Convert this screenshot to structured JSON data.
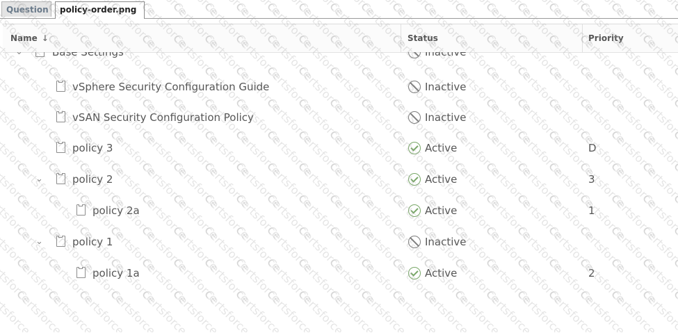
{
  "tabs": [
    {
      "label": "Question",
      "active": false
    },
    {
      "label": "policy-order.png",
      "active": true
    }
  ],
  "grid": {
    "columns": {
      "name": "Name",
      "status": "Status",
      "priority": "Priority"
    },
    "rows": [
      {
        "name": "Base Settings",
        "status": "Inactive",
        "priority": "",
        "expandable": true,
        "depth": 0,
        "icon": "document-icon"
      },
      {
        "name": "vSphere Security Configuration Guide",
        "status": "Inactive",
        "priority": "",
        "expandable": false,
        "depth": 1,
        "icon": "document-icon"
      },
      {
        "name": "vSAN Security Configuration Policy",
        "status": "Inactive",
        "priority": "",
        "expandable": false,
        "depth": 1,
        "icon": "document-icon"
      },
      {
        "name": "policy 3",
        "status": "Active",
        "priority": "D",
        "expandable": false,
        "depth": 1,
        "icon": "document-icon"
      },
      {
        "name": "policy 2",
        "status": "Active",
        "priority": "3",
        "expandable": true,
        "depth": 1,
        "icon": "document-icon"
      },
      {
        "name": "policy 2a",
        "status": "Active",
        "priority": "1",
        "expandable": false,
        "depth": 2,
        "icon": "document-icon"
      },
      {
        "name": "policy 1",
        "status": "Inactive",
        "priority": "",
        "expandable": true,
        "depth": 1,
        "icon": "document-icon"
      },
      {
        "name": "policy 1a",
        "status": "Active",
        "priority": "2",
        "expandable": false,
        "depth": 2,
        "icon": "document-icon"
      }
    ]
  },
  "watermark": "Certsforce",
  "colors": {
    "active": "#7aa869",
    "inactive": "#7d7d7d"
  }
}
